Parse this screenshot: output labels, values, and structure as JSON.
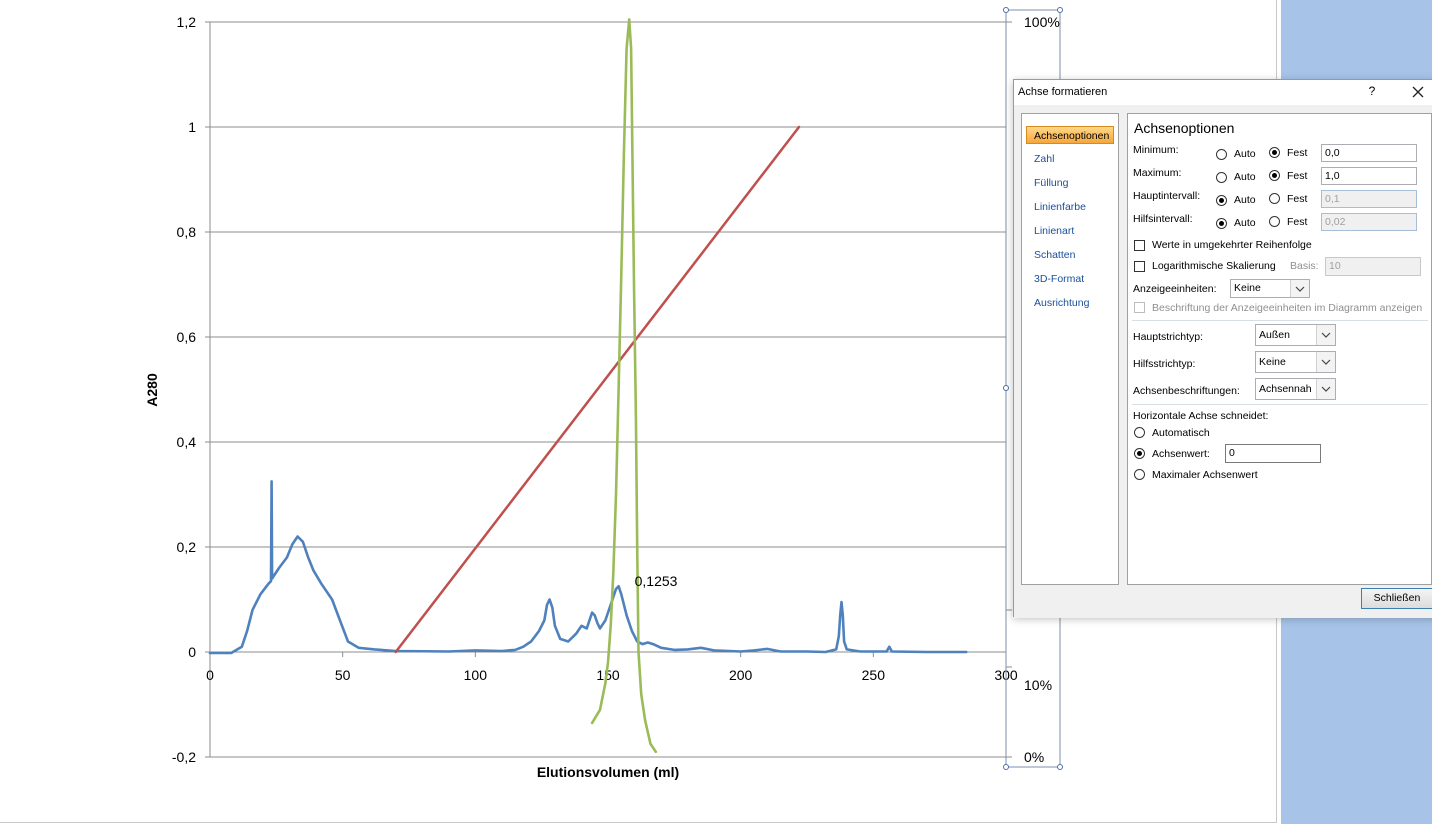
{
  "chart_data": {
    "type": "line",
    "xlabel": "Elutionsvolumen (ml)",
    "ylabel": "A280",
    "xlim": [
      0,
      300
    ],
    "ylim": [
      -0.2,
      1.2
    ],
    "x_ticks": [
      "0",
      "50",
      "100",
      "150",
      "200",
      "250",
      "300"
    ],
    "y_ticks": [
      "1,2",
      "1",
      "0,8",
      "0,6",
      "0,4",
      "0,2",
      "0",
      "-0,2"
    ],
    "y2_ticks": [
      "100%",
      "10%",
      "0%"
    ],
    "grid": true,
    "data_labels": [
      {
        "x": 154,
        "y": 0.1253,
        "text": "0,1253"
      }
    ],
    "series": [
      {
        "color": "#4f81bd",
        "points": [
          [
            0,
            -0.002
          ],
          [
            8,
            -0.002
          ],
          [
            12,
            0.01
          ],
          [
            14,
            0.04
          ],
          [
            16,
            0.08
          ],
          [
            19,
            0.11
          ],
          [
            22,
            0.13
          ],
          [
            23,
            0.135
          ],
          [
            23.2,
            0.325
          ],
          [
            23.4,
            0.14
          ],
          [
            26,
            0.16
          ],
          [
            29,
            0.18
          ],
          [
            31,
            0.205
          ],
          [
            33,
            0.22
          ],
          [
            35,
            0.21
          ],
          [
            37,
            0.18
          ],
          [
            39,
            0.155
          ],
          [
            42,
            0.13
          ],
          [
            46,
            0.1
          ],
          [
            49,
            0.06
          ],
          [
            52,
            0.02
          ],
          [
            56,
            0.008
          ],
          [
            62,
            0.005
          ],
          [
            70,
            0.002
          ],
          [
            90,
            0.001
          ],
          [
            100,
            0.003
          ],
          [
            110,
            0.002
          ],
          [
            115,
            0.004
          ],
          [
            118,
            0.01
          ],
          [
            121,
            0.02
          ],
          [
            124,
            0.04
          ],
          [
            126,
            0.06
          ],
          [
            127,
            0.09
          ],
          [
            128,
            0.1
          ],
          [
            129,
            0.085
          ],
          [
            130,
            0.05
          ],
          [
            132,
            0.025
          ],
          [
            135,
            0.02
          ],
          [
            138,
            0.035
          ],
          [
            140,
            0.05
          ],
          [
            142,
            0.045
          ],
          [
            143,
            0.06
          ],
          [
            144,
            0.075
          ],
          [
            145,
            0.07
          ],
          [
            146,
            0.055
          ],
          [
            147,
            0.045
          ],
          [
            149,
            0.06
          ],
          [
            151,
            0.09
          ],
          [
            153,
            0.12
          ],
          [
            154,
            0.1253
          ],
          [
            155,
            0.11
          ],
          [
            157,
            0.07
          ],
          [
            159,
            0.04
          ],
          [
            161,
            0.02
          ],
          [
            163,
            0.015
          ],
          [
            165,
            0.018
          ],
          [
            167,
            0.015
          ],
          [
            170,
            0.008
          ],
          [
            175,
            0.004
          ],
          [
            180,
            0.005
          ],
          [
            185,
            0.008
          ],
          [
            190,
            0.003
          ],
          [
            200,
            0.001
          ],
          [
            205,
            0.003
          ],
          [
            210,
            0.006
          ],
          [
            215,
            0.001
          ],
          [
            225,
            0.001
          ],
          [
            232,
            0.0
          ],
          [
            236,
            0.005
          ],
          [
            237,
            0.03
          ],
          [
            237.5,
            0.07
          ],
          [
            238,
            0.095
          ],
          [
            238.5,
            0.07
          ],
          [
            239,
            0.02
          ],
          [
            240,
            0.005
          ],
          [
            245,
            0.001
          ],
          [
            255,
            0.001
          ],
          [
            256,
            0.01
          ],
          [
            257,
            0.001
          ],
          [
            270,
            0.0
          ],
          [
            285,
            0.0
          ]
        ]
      },
      {
        "color": "#c0504d",
        "points": [
          [
            70,
            0.0
          ],
          [
            222,
            1.0
          ]
        ]
      },
      {
        "color": "#9bbb59",
        "points": [
          [
            144,
            -0.135
          ],
          [
            147,
            -0.11
          ],
          [
            149,
            -0.06
          ],
          [
            150,
            -0.02
          ],
          [
            151,
            0.05
          ],
          [
            152,
            0.15
          ],
          [
            153,
            0.3
          ],
          [
            154,
            0.5
          ],
          [
            155,
            0.72
          ],
          [
            156,
            0.95
          ],
          [
            157,
            1.15
          ],
          [
            158,
            1.205
          ],
          [
            158.7,
            1.15
          ],
          [
            159.2,
            0.95
          ],
          [
            159.8,
            0.7
          ],
          [
            160.5,
            0.45
          ],
          [
            161,
            0.2
          ],
          [
            161.5,
            0.0
          ],
          [
            162.5,
            -0.08
          ],
          [
            164,
            -0.13
          ],
          [
            166,
            -0.175
          ],
          [
            168,
            -0.19
          ]
        ]
      }
    ]
  },
  "dialog": {
    "title": "Achse formatieren",
    "help": "?",
    "nav": [
      "Achsenoptionen",
      "Zahl",
      "Füllung",
      "Linienfarbe",
      "Linienart",
      "Schatten",
      "3D-Format",
      "Ausrichtung"
    ],
    "section_title": "Achsenoptionen",
    "minimum_label": "Minimum:",
    "maximum_label": "Maximum:",
    "major_label": "Hauptintervall:",
    "minor_label": "Hilfsintervall:",
    "auto": "Auto",
    "fixed": "Fest",
    "minimum_value": "0,0",
    "maximum_value": "1,0",
    "major_value": "0,1",
    "minor_value": "0,02",
    "reverse_label": "Werte in umgekehrter Reihenfolge",
    "log_label": "Logarithmische Skalierung",
    "basis_label": "Basis:",
    "basis_value": "10",
    "units_label": "Anzeigeeinheiten:",
    "units_value": "Keine",
    "units_caption_label": "Beschriftung der Anzeigeeinheiten im Diagramm anzeigen",
    "major_tick_label": "Hauptstrichtyp:",
    "major_tick_value": "Außen",
    "minor_tick_label": "Hilfsstrichtyp:",
    "minor_tick_value": "Keine",
    "axis_labels_label": "Achsenbeschriftungen:",
    "axis_labels_value": "Achsennah",
    "crosses_label": "Horizontale Achse schneidet:",
    "crosses_auto": "Automatisch",
    "crosses_value_label": "Achsenwert:",
    "crosses_value": "0",
    "crosses_max": "Maximaler Achsenwert",
    "close_button": "Schließen"
  }
}
